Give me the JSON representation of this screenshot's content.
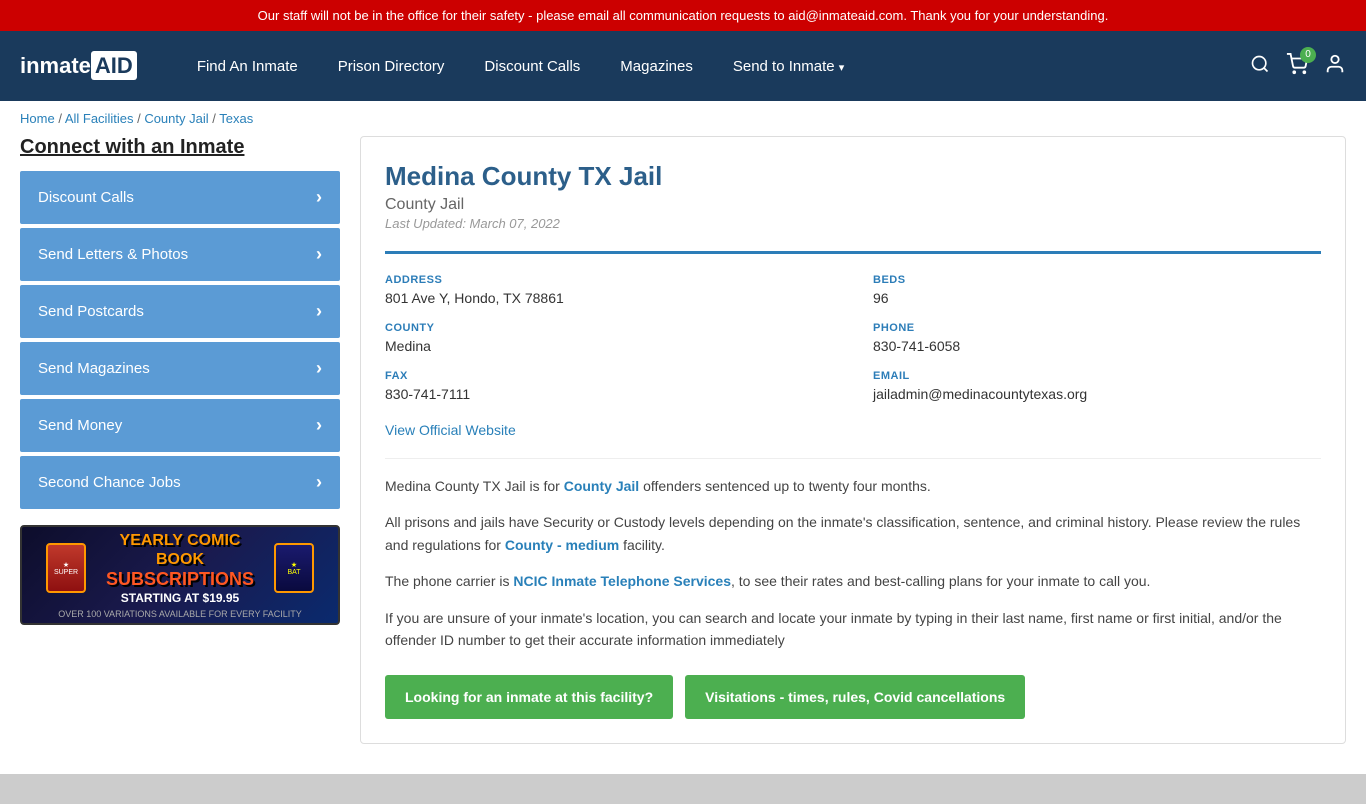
{
  "alert": {
    "text": "Our staff will not be in the office for their safety - please email all communication requests to aid@inmateaid.com. Thank you for your understanding."
  },
  "nav": {
    "logo": "inmateAID",
    "links": [
      {
        "label": "Find An Inmate",
        "id": "find-inmate",
        "dropdown": false
      },
      {
        "label": "Prison Directory",
        "id": "prison-directory",
        "dropdown": false
      },
      {
        "label": "Discount Calls",
        "id": "discount-calls",
        "dropdown": false
      },
      {
        "label": "Magazines",
        "id": "magazines",
        "dropdown": false
      },
      {
        "label": "Send to Inmate",
        "id": "send-to-inmate",
        "dropdown": true
      }
    ],
    "cart_count": "0"
  },
  "breadcrumb": {
    "items": [
      "Home",
      "All Facilities",
      "County Jail",
      "Texas"
    ],
    "separator": " / "
  },
  "sidebar": {
    "connect_title": "Connect with an Inmate",
    "buttons": [
      {
        "label": "Discount Calls",
        "id": "btn-discount-calls"
      },
      {
        "label": "Send Letters & Photos",
        "id": "btn-letters"
      },
      {
        "label": "Send Postcards",
        "id": "btn-postcards"
      },
      {
        "label": "Send Magazines",
        "id": "btn-magazines"
      },
      {
        "label": "Send Money",
        "id": "btn-send-money"
      },
      {
        "label": "Second Chance Jobs",
        "id": "btn-jobs"
      }
    ],
    "ad": {
      "line1": "YEARLY COMIC BOOK",
      "line2": "SUBSCRIPTIONS",
      "line3": "STARTING AT $19.95",
      "line4": "OVER 100 VARIATIONS AVAILABLE FOR EVERY FACILITY"
    }
  },
  "facility": {
    "name": "Medina County TX Jail",
    "type": "County Jail",
    "last_updated": "Last Updated: March 07, 2022",
    "address_label": "ADDRESS",
    "address_value": "801 Ave Y, Hondo, TX 78861",
    "beds_label": "BEDS",
    "beds_value": "96",
    "county_label": "COUNTY",
    "county_value": "Medina",
    "phone_label": "PHONE",
    "phone_value": "830-741-6058",
    "fax_label": "FAX",
    "fax_value": "830-741-7111",
    "email_label": "EMAIL",
    "email_value": "jailadmin@medinacountytexas.org",
    "official_website_label": "View Official Website",
    "official_website_url": "#",
    "desc1": "Medina County TX Jail is for County Jail offenders sentenced up to twenty four months.",
    "desc1_link": "County Jail",
    "desc2": "All prisons and jails have Security or Custody levels depending on the inmate's classification, sentence, and criminal history. Please review the rules and regulations for County - medium facility.",
    "desc2_link": "County - medium",
    "desc3": "The phone carrier is NCIC Inmate Telephone Services, to see their rates and best-calling plans for your inmate to call you.",
    "desc3_link": "NCIC Inmate Telephone Services",
    "desc4": "If you are unsure of your inmate's location, you can search and locate your inmate by typing in their last name, first name or first initial, and/or the offender ID number to get their accurate information immediately",
    "btn1": "Looking for an inmate at this facility?",
    "btn2": "Visitations - times, rules, Covid cancellations"
  }
}
